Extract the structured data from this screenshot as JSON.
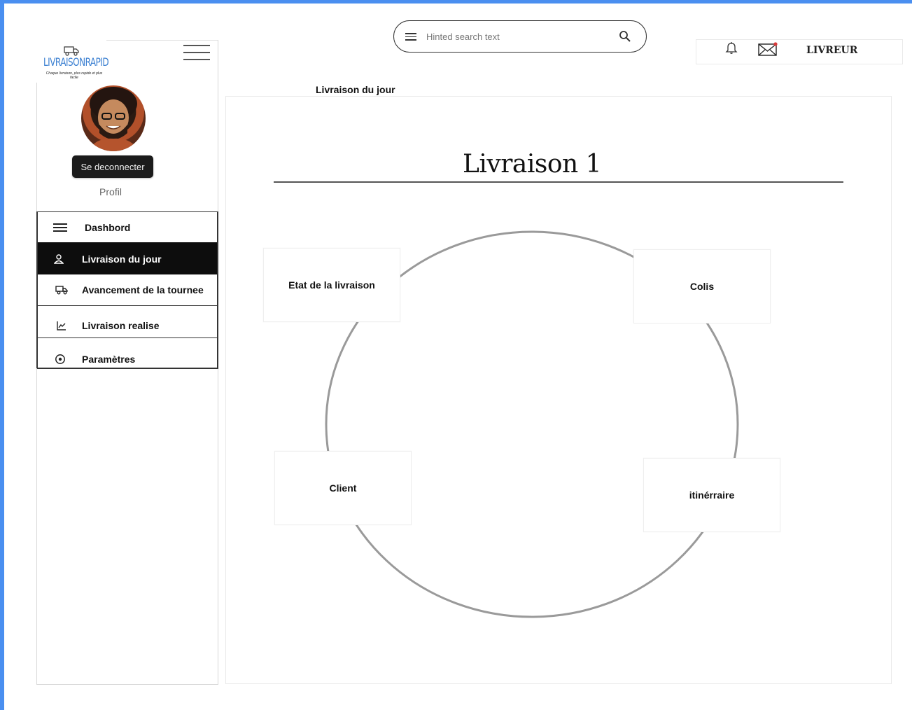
{
  "brand": {
    "name": "LIVRAISONRAPID",
    "tagline": "Chaque livraison, plus rapide et plus facile"
  },
  "sidebar": {
    "logout_label": "Se deconnecter",
    "profile_label": "Profil",
    "items": [
      {
        "label": "Dashbord",
        "icon": "menu-icon",
        "active": false
      },
      {
        "label": "Livraison du jour",
        "icon": "user-icon",
        "active": true
      },
      {
        "label": "Avancement de la tournee",
        "icon": "truck-icon",
        "active": false
      },
      {
        "label": "Livraison realise",
        "icon": "chart-icon",
        "active": false
      },
      {
        "label": "Paramètres",
        "icon": "gear-icon",
        "active": false
      }
    ]
  },
  "header": {
    "search_placeholder": "Hinted search text",
    "role": "LIVREUR"
  },
  "main": {
    "page_label": "Livraison du jour",
    "title": "Livraison 1",
    "cards": {
      "etat": "Etat de la livraison",
      "colis": "Colis",
      "client": "Client",
      "itineraire": "itinérraire"
    }
  },
  "colors": {
    "frame": "#4a8ff0",
    "active_nav": "#0d0d0d",
    "logo_blue": "#3a7fd1"
  }
}
